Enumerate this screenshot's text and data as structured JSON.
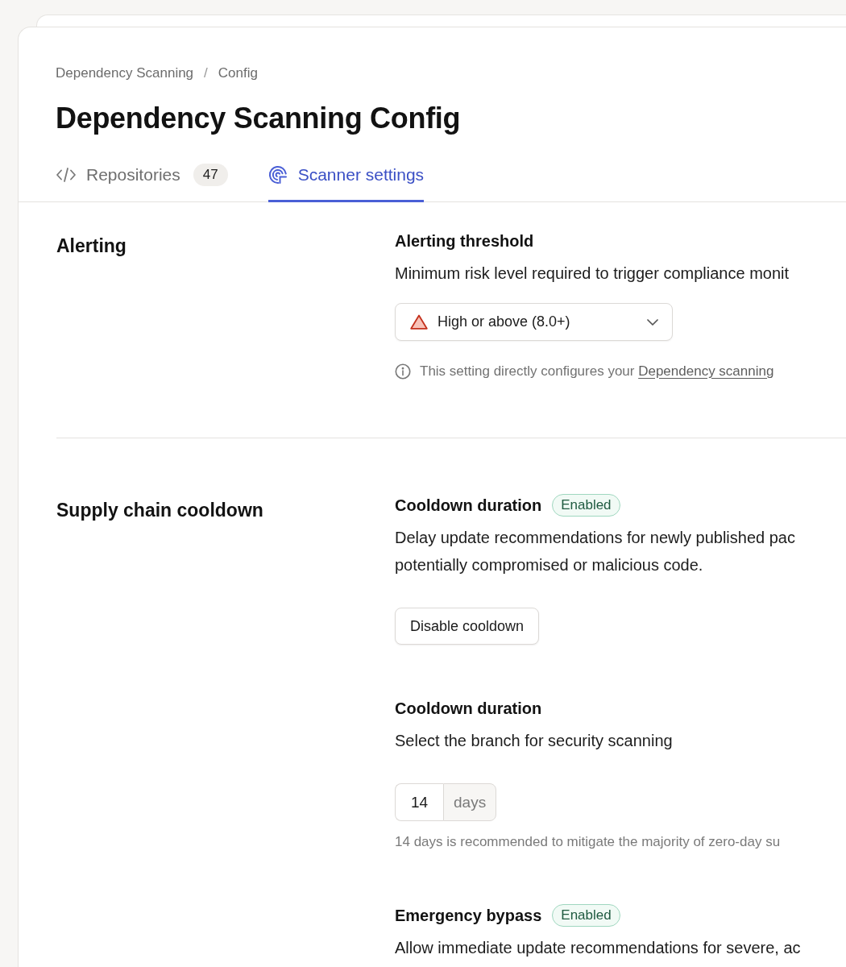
{
  "breadcrumb": {
    "items": [
      "Dependency Scanning",
      "Config"
    ],
    "separator": "/"
  },
  "title": "Dependency Scanning Config",
  "tabs": [
    {
      "label": "Repositories",
      "count": "47",
      "selected": false
    },
    {
      "label": "Scanner settings",
      "selected": true
    }
  ],
  "sections": [
    {
      "heading": "Alerting",
      "settings": [
        {
          "kind": "select",
          "title": "Alerting threshold",
          "description": [
            "Minimum risk level required to trigger compliance monit"
          ],
          "select": {
            "value": "High or above (8.0+)"
          },
          "note": {
            "text": "This setting directly configures your",
            "link": "Dependency scanning"
          }
        }
      ]
    },
    {
      "heading": "Supply chain cooldown",
      "settings": [
        {
          "kind": "button",
          "title": "Cooldown duration",
          "badge": "Enabled",
          "description": [
            "Delay update recommendations for newly published pac",
            "potentially compromised or malicious code."
          ],
          "button": "Disable cooldown"
        },
        {
          "kind": "number",
          "title": "Cooldown duration",
          "description": [
            "Select the branch for security scanning"
          ],
          "input": {
            "value": "14",
            "unit": "days"
          },
          "hint": "14 days is recommended to mitigate the majority of zero-day su"
        },
        {
          "kind": "text",
          "title": "Emergency bypass",
          "badge": "Enabled",
          "description": [
            "Allow immediate update recommendations for severe, ac"
          ]
        }
      ]
    }
  ]
}
